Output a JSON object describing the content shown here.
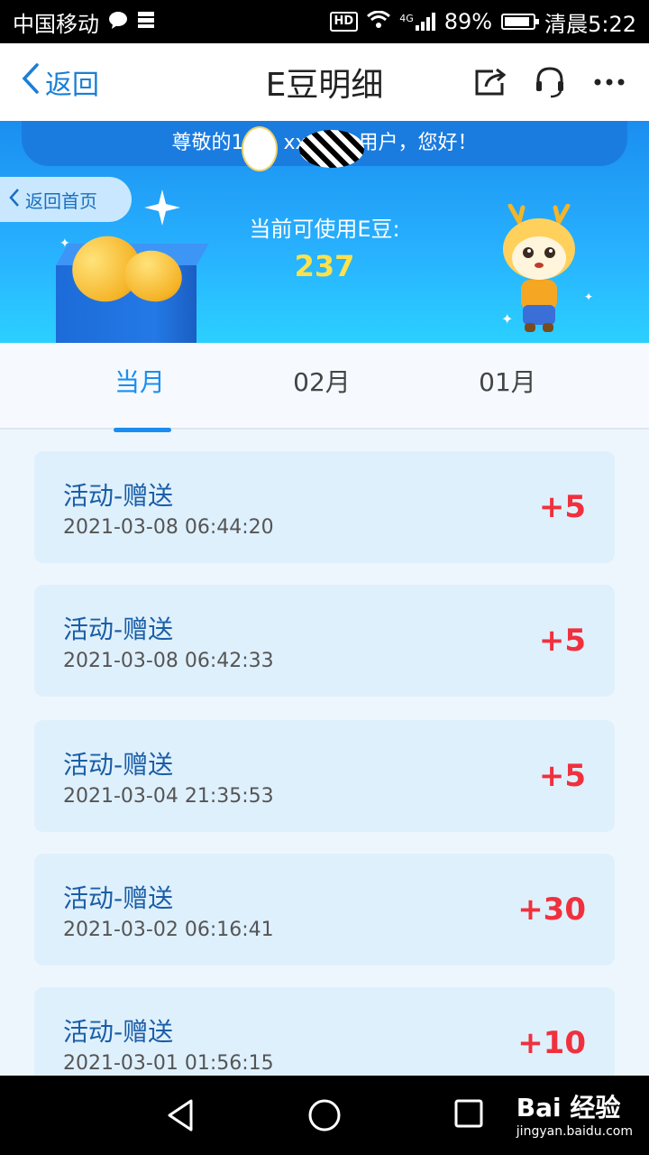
{
  "status_bar": {
    "carrier": "中国移动",
    "network": "4G",
    "battery": "89%",
    "time": "清晨5:22"
  },
  "header": {
    "back_label": "返回",
    "title": "E豆明细"
  },
  "banner": {
    "greeting": "尊敬的1　　xxx　　用户，您好！",
    "home_label": "返回首页",
    "available_label": "当前可使用E豆:",
    "available_value": "237"
  },
  "tabs": [
    {
      "label": "当月",
      "active": true
    },
    {
      "label": "02月"
    },
    {
      "label": "01月"
    }
  ],
  "records": [
    {
      "title": "活动-赠送",
      "time": "2021-03-08 06:44:20",
      "amount": "+5"
    },
    {
      "title": "活动-赠送",
      "time": "2021-03-08 06:42:33",
      "amount": "+5"
    },
    {
      "title": "活动-赠送",
      "time": "2021-03-04 21:35:53",
      "amount": "+5"
    },
    {
      "title": "活动-赠送",
      "time": "2021-03-02 06:16:41",
      "amount": "+30"
    },
    {
      "title": "活动-赠送",
      "time": "2021-03-01 01:56:15",
      "amount": "+10"
    }
  ],
  "watermark": {
    "brand": "Bai 经验",
    "url": "jingyan.baidu.com"
  },
  "colors": {
    "accent": "#1a8ef0",
    "amount": "#f0313d",
    "card": "#dff0fd"
  }
}
